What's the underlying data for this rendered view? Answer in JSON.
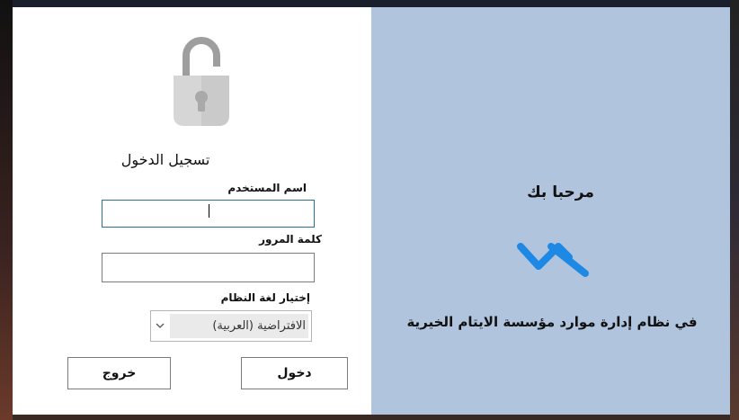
{
  "login": {
    "title": "تسجيل الدخول",
    "username_label": "اسم المستخدم",
    "username_value": "",
    "password_label": "كلمة المرور",
    "password_value": "",
    "language_label": "إختيار لغة النظام",
    "language_selected": "الافتراضية (العربية)",
    "login_button": "دخول",
    "exit_button": "خروج"
  },
  "welcome": {
    "title": "مرحبا بك",
    "subtitle": "في نظام إدارة موارد مؤسسة الايتام الخيرية"
  },
  "icons": {
    "lock": "unlocked-padlock-icon",
    "logo": "app-logo-icon",
    "dropdown": "chevron-down-icon"
  },
  "colors": {
    "welcome_panel": "#b0c4de",
    "logo_blue": "#1e88e5",
    "focused_border": "#2c6e94"
  }
}
